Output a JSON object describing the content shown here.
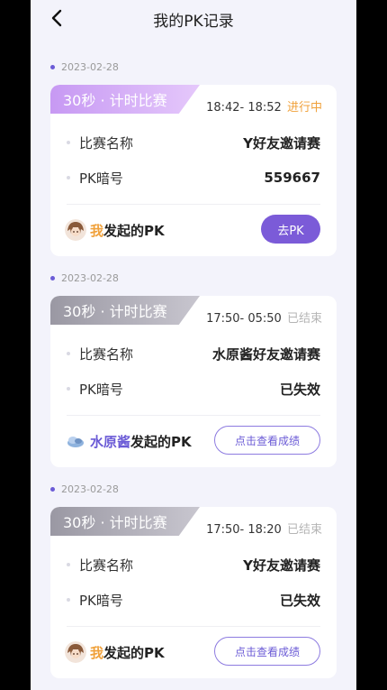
{
  "header": {
    "title": "我的PK记录"
  },
  "records": [
    {
      "date": "2023-02-28",
      "tag": "30秒 · 计时比赛",
      "time": "18:42- 18:52",
      "status": "进行中",
      "name_label": "比赛名称",
      "name_value": "Y好友邀请赛",
      "code_label": "PK暗号",
      "code_value": "559667",
      "initiator": "我",
      "initiator_suffix": "发起的PK",
      "action_label": "去PK"
    },
    {
      "date": "2023-02-28",
      "tag": "30秒 · 计时比赛",
      "time": "17:50- 05:50",
      "status": "已结束",
      "name_label": "比赛名称",
      "name_value": "水原酱好友邀请赛",
      "code_label": "PK暗号",
      "code_value": "已失效",
      "initiator": "水原酱",
      "initiator_suffix": "发起的PK",
      "action_label": "点击查看成绩"
    },
    {
      "date": "2023-02-28",
      "tag": "30秒 · 计时比赛",
      "time": "17:50- 18:20",
      "status": "已结束",
      "name_label": "比赛名称",
      "name_value": "Y好友邀请赛",
      "code_label": "PK暗号",
      "code_value": "已失效",
      "initiator": "我",
      "initiator_suffix": "发起的PK",
      "action_label": "点击查看成绩"
    }
  ],
  "colors": {
    "accent": "#7b5bd8",
    "active_status": "#f0a13b",
    "ended_status": "#b5b5b5"
  },
  "icons": [
    "back-arrow-icon",
    "avatar-girl-icon",
    "avatar-cloud-icon"
  ]
}
